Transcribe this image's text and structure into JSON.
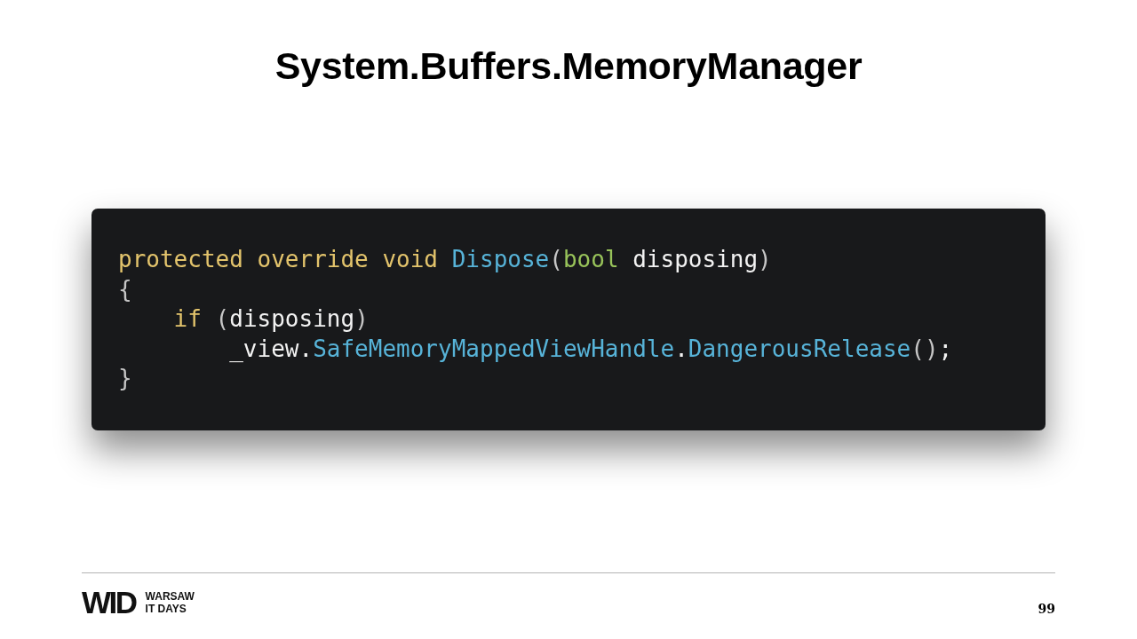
{
  "title": "System.Buffers.MemoryManager",
  "code": {
    "lines": [
      {
        "tokens": [
          {
            "kind": "keyword",
            "text": "protected override void"
          },
          {
            "kind": "method",
            "text": " Dispose"
          },
          {
            "kind": "punct",
            "text": "("
          },
          {
            "kind": "type",
            "text": "bool"
          },
          {
            "kind": "plain",
            "text": " disposing"
          },
          {
            "kind": "punct",
            "text": ")"
          }
        ]
      },
      {
        "tokens": [
          {
            "kind": "punct",
            "text": "{"
          }
        ],
        "children": [
          {
            "tokens": [
              {
                "kind": "keyword",
                "text": "if"
              },
              {
                "kind": "punct",
                "text": " ("
              },
              {
                "kind": "plain",
                "text": "disposing"
              },
              {
                "kind": "punct",
                "text": ")"
              }
            ],
            "children": [
              {
                "tokens": [
                  {
                    "kind": "plain",
                    "text": "_view."
                  },
                  {
                    "kind": "method",
                    "text": "SafeMemoryMappedViewHandle"
                  },
                  {
                    "kind": "plain",
                    "text": "."
                  },
                  {
                    "kind": "method",
                    "text": "DangerousRelease"
                  },
                  {
                    "kind": "punct",
                    "text": "()"
                  },
                  {
                    "kind": "plain",
                    "text": ";"
                  }
                ]
              }
            ]
          }
        ]
      },
      {
        "tokens": [
          {
            "kind": "punct",
            "text": "}"
          }
        ]
      }
    ]
  },
  "footer": {
    "logo": {
      "mark": "WID",
      "lines": [
        "WARSAW",
        "IT DAYS"
      ]
    },
    "page_number": "99"
  }
}
